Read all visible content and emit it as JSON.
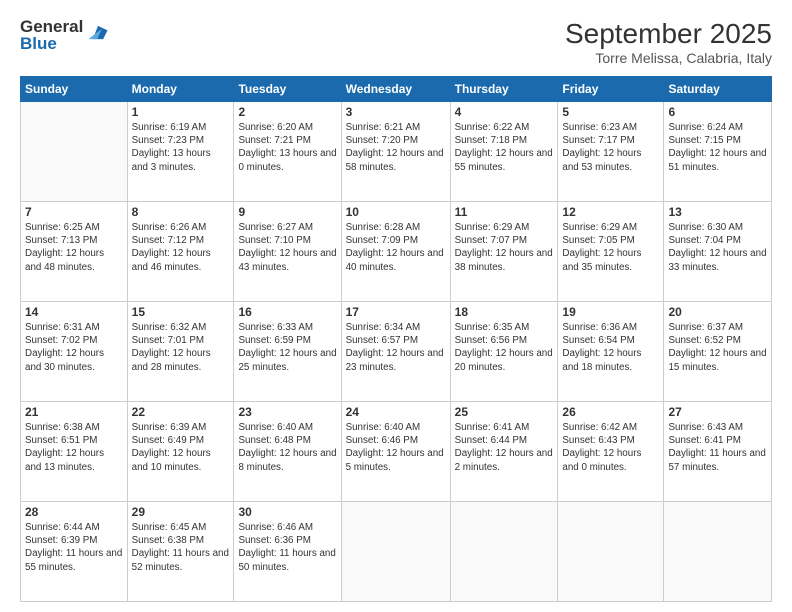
{
  "logo": {
    "general": "General",
    "blue": "Blue"
  },
  "header": {
    "month": "September 2025",
    "location": "Torre Melissa, Calabria, Italy"
  },
  "weekdays": [
    "Sunday",
    "Monday",
    "Tuesday",
    "Wednesday",
    "Thursday",
    "Friday",
    "Saturday"
  ],
  "weeks": [
    [
      {
        "day": null
      },
      {
        "day": 1,
        "sunrise": "6:19 AM",
        "sunset": "7:23 PM",
        "daylight": "13 hours and 3 minutes."
      },
      {
        "day": 2,
        "sunrise": "6:20 AM",
        "sunset": "7:21 PM",
        "daylight": "13 hours and 0 minutes."
      },
      {
        "day": 3,
        "sunrise": "6:21 AM",
        "sunset": "7:20 PM",
        "daylight": "12 hours and 58 minutes."
      },
      {
        "day": 4,
        "sunrise": "6:22 AM",
        "sunset": "7:18 PM",
        "daylight": "12 hours and 55 minutes."
      },
      {
        "day": 5,
        "sunrise": "6:23 AM",
        "sunset": "7:17 PM",
        "daylight": "12 hours and 53 minutes."
      },
      {
        "day": 6,
        "sunrise": "6:24 AM",
        "sunset": "7:15 PM",
        "daylight": "12 hours and 51 minutes."
      }
    ],
    [
      {
        "day": 7,
        "sunrise": "6:25 AM",
        "sunset": "7:13 PM",
        "daylight": "12 hours and 48 minutes."
      },
      {
        "day": 8,
        "sunrise": "6:26 AM",
        "sunset": "7:12 PM",
        "daylight": "12 hours and 46 minutes."
      },
      {
        "day": 9,
        "sunrise": "6:27 AM",
        "sunset": "7:10 PM",
        "daylight": "12 hours and 43 minutes."
      },
      {
        "day": 10,
        "sunrise": "6:28 AM",
        "sunset": "7:09 PM",
        "daylight": "12 hours and 40 minutes."
      },
      {
        "day": 11,
        "sunrise": "6:29 AM",
        "sunset": "7:07 PM",
        "daylight": "12 hours and 38 minutes."
      },
      {
        "day": 12,
        "sunrise": "6:29 AM",
        "sunset": "7:05 PM",
        "daylight": "12 hours and 35 minutes."
      },
      {
        "day": 13,
        "sunrise": "6:30 AM",
        "sunset": "7:04 PM",
        "daylight": "12 hours and 33 minutes."
      }
    ],
    [
      {
        "day": 14,
        "sunrise": "6:31 AM",
        "sunset": "7:02 PM",
        "daylight": "12 hours and 30 minutes."
      },
      {
        "day": 15,
        "sunrise": "6:32 AM",
        "sunset": "7:01 PM",
        "daylight": "12 hours and 28 minutes."
      },
      {
        "day": 16,
        "sunrise": "6:33 AM",
        "sunset": "6:59 PM",
        "daylight": "12 hours and 25 minutes."
      },
      {
        "day": 17,
        "sunrise": "6:34 AM",
        "sunset": "6:57 PM",
        "daylight": "12 hours and 23 minutes."
      },
      {
        "day": 18,
        "sunrise": "6:35 AM",
        "sunset": "6:56 PM",
        "daylight": "12 hours and 20 minutes."
      },
      {
        "day": 19,
        "sunrise": "6:36 AM",
        "sunset": "6:54 PM",
        "daylight": "12 hours and 18 minutes."
      },
      {
        "day": 20,
        "sunrise": "6:37 AM",
        "sunset": "6:52 PM",
        "daylight": "12 hours and 15 minutes."
      }
    ],
    [
      {
        "day": 21,
        "sunrise": "6:38 AM",
        "sunset": "6:51 PM",
        "daylight": "12 hours and 13 minutes."
      },
      {
        "day": 22,
        "sunrise": "6:39 AM",
        "sunset": "6:49 PM",
        "daylight": "12 hours and 10 minutes."
      },
      {
        "day": 23,
        "sunrise": "6:40 AM",
        "sunset": "6:48 PM",
        "daylight": "12 hours and 8 minutes."
      },
      {
        "day": 24,
        "sunrise": "6:40 AM",
        "sunset": "6:46 PM",
        "daylight": "12 hours and 5 minutes."
      },
      {
        "day": 25,
        "sunrise": "6:41 AM",
        "sunset": "6:44 PM",
        "daylight": "12 hours and 2 minutes."
      },
      {
        "day": 26,
        "sunrise": "6:42 AM",
        "sunset": "6:43 PM",
        "daylight": "12 hours and 0 minutes."
      },
      {
        "day": 27,
        "sunrise": "6:43 AM",
        "sunset": "6:41 PM",
        "daylight": "11 hours and 57 minutes."
      }
    ],
    [
      {
        "day": 28,
        "sunrise": "6:44 AM",
        "sunset": "6:39 PM",
        "daylight": "11 hours and 55 minutes."
      },
      {
        "day": 29,
        "sunrise": "6:45 AM",
        "sunset": "6:38 PM",
        "daylight": "11 hours and 52 minutes."
      },
      {
        "day": 30,
        "sunrise": "6:46 AM",
        "sunset": "6:36 PM",
        "daylight": "11 hours and 50 minutes."
      },
      {
        "day": null
      },
      {
        "day": null
      },
      {
        "day": null
      },
      {
        "day": null
      }
    ]
  ],
  "labels": {
    "sunrise": "Sunrise:",
    "sunset": "Sunset:",
    "daylight": "Daylight hours"
  }
}
